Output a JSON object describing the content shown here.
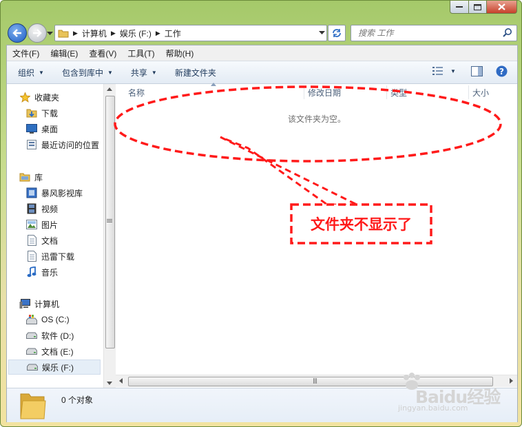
{
  "window": {
    "caption_icons": [
      "minimize-icon",
      "maximize-icon",
      "close-icon"
    ]
  },
  "address_bar": {
    "segments": [
      "计算机",
      "娱乐 (F:)",
      "工作"
    ]
  },
  "search": {
    "placeholder": "搜索 工作"
  },
  "menubar": {
    "items": [
      "文件(F)",
      "编辑(E)",
      "查看(V)",
      "工具(T)",
      "帮助(H)"
    ]
  },
  "toolbar": {
    "organize": "组织",
    "include_in_library": "包含到库中",
    "share": "共享",
    "new_folder": "新建文件夹"
  },
  "sidebar": {
    "favorites": {
      "label": "收藏夹",
      "items": [
        "下载",
        "桌面",
        "最近访问的位置"
      ]
    },
    "libraries": {
      "label": "库",
      "items": [
        "暴风影视库",
        "视频",
        "图片",
        "文档",
        "迅雷下载",
        "音乐"
      ]
    },
    "computer": {
      "label": "计算机",
      "items": [
        "OS (C:)",
        "软件 (D:)",
        "文档 (E:)",
        "娱乐 (F:)"
      ],
      "selected": "娱乐 (F:)"
    }
  },
  "columns": [
    "名称",
    "修改日期",
    "类型",
    "大小"
  ],
  "content": {
    "empty_message": "该文件夹为空。"
  },
  "details_pane": {
    "count_text": "0 个对象"
  },
  "annotation": {
    "callout_text": "文件夹不显示了",
    "color": "#ff1a1a"
  },
  "watermark": {
    "brand": "Baidu经验",
    "url": "jingyan.baidu.com"
  }
}
